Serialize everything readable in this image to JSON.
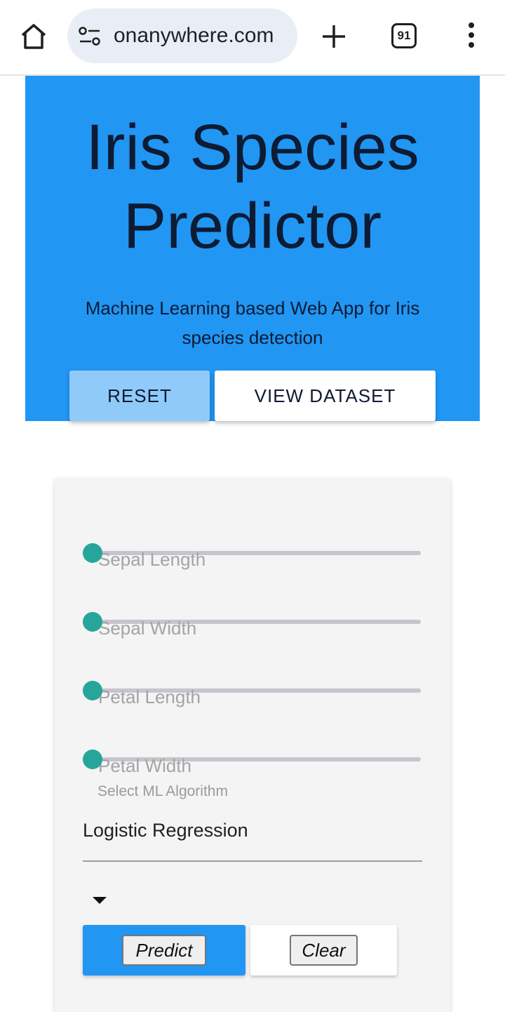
{
  "browser": {
    "url_text": "onanywhere.com",
    "tab_count": "91"
  },
  "hero": {
    "title": "Iris Species Predictor",
    "subtitle": "Machine Learning based Web App for Iris species detection",
    "reset_label": "RESET",
    "view_dataset_label": "VIEW DATASET",
    "background_color": "#2196f3"
  },
  "form": {
    "sliders": [
      {
        "label": "Sepal Length",
        "value": 0
      },
      {
        "label": "Sepal Width",
        "value": 0
      },
      {
        "label": "Petal Length",
        "value": 0
      },
      {
        "label": "Petal Width",
        "value": 0
      }
    ],
    "select_label": "Select ML Algorithm",
    "select_value": "Logistic Regression",
    "predict_label": "Predict",
    "clear_label": "Clear",
    "slider_thumb_color": "#26a69a"
  }
}
